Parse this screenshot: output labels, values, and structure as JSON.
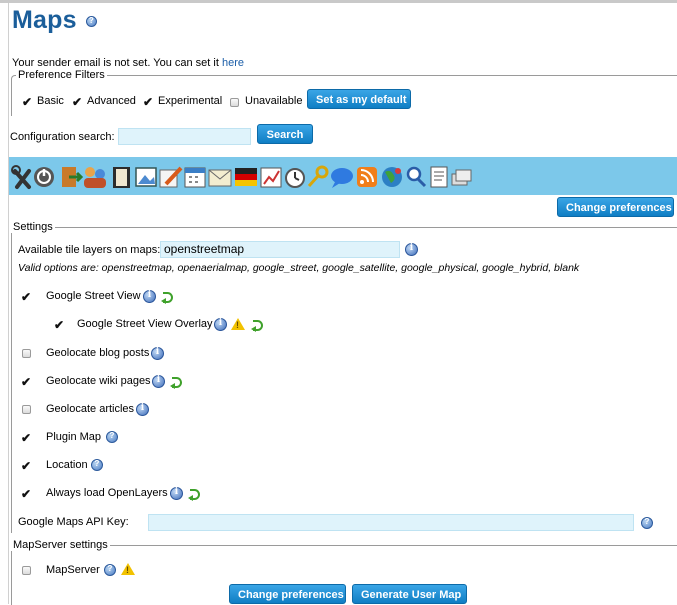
{
  "page": {
    "title": "Maps",
    "sender_notice_prefix": "Your sender email is not set. You can set it ",
    "sender_notice_link": "here"
  },
  "preference_filters": {
    "legend": "Preference Filters",
    "options": [
      {
        "label": "Basic",
        "checked": true
      },
      {
        "label": "Advanced",
        "checked": true
      },
      {
        "label": "Experimental",
        "checked": true
      },
      {
        "label": "Unavailable",
        "checked": false
      }
    ],
    "default_button": "Set as my default"
  },
  "config_search": {
    "label": "Configuration search:",
    "value": "",
    "button": "Search"
  },
  "toolbar": {
    "icons": [
      "tools-icon",
      "power-icon",
      "login-icon",
      "users-icon",
      "book-icon",
      "image-icon",
      "edit-icon",
      "calendar-icon",
      "mail-icon",
      "flag-icon",
      "chart-icon",
      "clock-icon",
      "key-icon",
      "chat-icon",
      "rss-icon",
      "globe-icon",
      "search-icon",
      "document-icon",
      "stack-icon"
    ],
    "change_preferences": "Change preferences"
  },
  "settings": {
    "legend": "Settings",
    "tile_layers_label": "Available tile layers on maps:",
    "tile_layers_value": "openstreetmap",
    "valid_options": "Valid options are: openstreetmap, openaerialmap, google_street, google_satellite, google_physical, google_hybrid, blank",
    "items": [
      {
        "label": "Google Street View",
        "checked": true
      },
      {
        "label": "Google Street View Overlay",
        "checked": true
      },
      {
        "label": "Geolocate blog posts",
        "checked": false
      },
      {
        "label": "Geolocate wiki pages",
        "checked": true
      },
      {
        "label": "Geolocate articles",
        "checked": false
      },
      {
        "label": "Plugin Map",
        "checked": true
      },
      {
        "label": "Location",
        "checked": true
      },
      {
        "label": "Always load OpenLayers",
        "checked": true
      }
    ],
    "api_key_label": "Google Maps API Key:",
    "api_key_value": ""
  },
  "mapserver": {
    "legend": "MapServer settings",
    "item": {
      "label": "MapServer",
      "checked": false
    }
  },
  "footer": {
    "change_preferences": "Change preferences",
    "generate_user_map": "Generate User Map"
  },
  "colors": {
    "title": "#1b5e9a",
    "button": "#1a8fd4",
    "toolbar": "#7cc8ea",
    "input": "#dff3fb"
  }
}
